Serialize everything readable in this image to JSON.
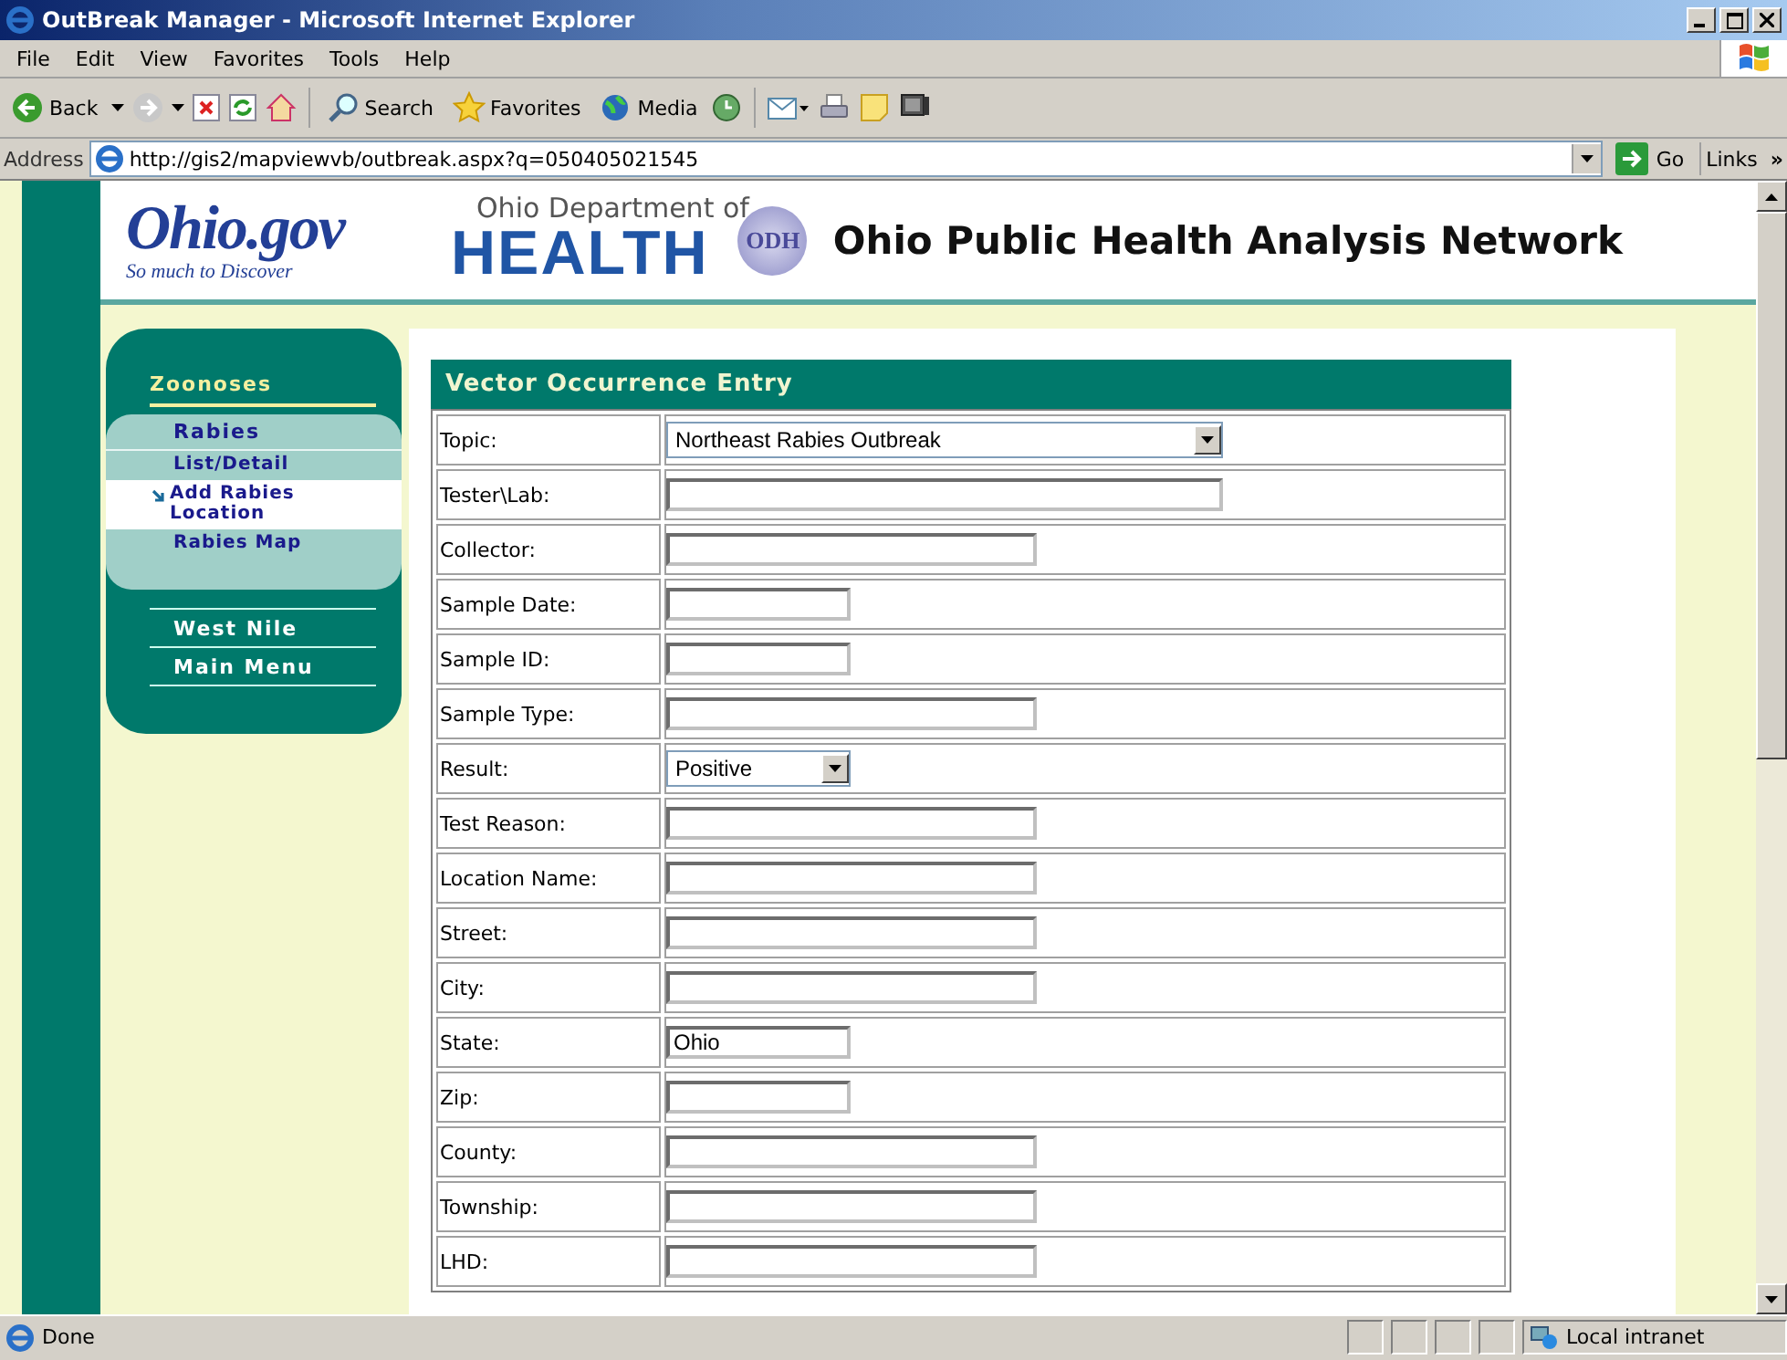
{
  "window": {
    "title": "OutBreak Manager - Microsoft Internet Explorer"
  },
  "menu": [
    "File",
    "Edit",
    "View",
    "Favorites",
    "Tools",
    "Help"
  ],
  "toolbar": [
    {
      "kind": "back",
      "label": "Back"
    },
    {
      "kind": "forward"
    },
    {
      "kind": "stop"
    },
    {
      "kind": "refresh"
    },
    {
      "kind": "home"
    },
    {
      "kind": "search",
      "label": "Search"
    },
    {
      "kind": "favorites",
      "label": "Favorites"
    },
    {
      "kind": "media",
      "label": "Media"
    },
    {
      "kind": "history"
    },
    {
      "kind": "mail"
    },
    {
      "kind": "print"
    },
    {
      "kind": "edit"
    },
    {
      "kind": "messenger"
    }
  ],
  "address": {
    "label": "Address",
    "url": "http://gis2/mapviewvb/outbreak.aspx?q=050405021545",
    "go": "Go",
    "links": "Links",
    "more": "»"
  },
  "header": {
    "state_logo": "Ohio.gov",
    "state_tagline": "So much to Discover",
    "dept_line": "Ohio Department of",
    "dept_name": "HEALTH",
    "seal": "ODH",
    "title": "Ohio Public Health Analysis Network"
  },
  "nav": {
    "section": "Zoonoses",
    "group": "Rabies",
    "items": [
      {
        "label": "List/Detail",
        "selected": false
      },
      {
        "label": "Add Rabies Location",
        "selected": true
      },
      {
        "label": "Rabies Map",
        "selected": false
      }
    ],
    "links": [
      "West Nile",
      "Main Menu"
    ]
  },
  "form": {
    "title": "Vector Occurrence Entry",
    "fields": [
      {
        "label": "Topic:",
        "kind": "select",
        "value": "Northeast Rabies Outbreak"
      },
      {
        "label": "Tester\\Lab:",
        "kind": "text"
      },
      {
        "label": "Collector:",
        "kind": "text"
      },
      {
        "label": "Sample Date:",
        "kind": "text"
      },
      {
        "label": "Sample ID:",
        "kind": "text"
      },
      {
        "label": "Sample Type:",
        "kind": "text"
      },
      {
        "label": "Result:",
        "kind": "select",
        "value": "Positive"
      },
      {
        "label": "Test Reason:",
        "kind": "text"
      },
      {
        "label": "Location Name:",
        "kind": "text"
      },
      {
        "label": "Street:",
        "kind": "text"
      },
      {
        "label": "City:",
        "kind": "text"
      },
      {
        "label": "State:",
        "kind": "text",
        "value": "Ohio"
      },
      {
        "label": "Zip:",
        "kind": "text"
      },
      {
        "label": "County:",
        "kind": "text"
      },
      {
        "label": "Township:",
        "kind": "text"
      },
      {
        "label": "LHD:",
        "kind": "text"
      }
    ]
  },
  "status_bar": {
    "text": "Done",
    "zone": "Local intranet"
  }
}
